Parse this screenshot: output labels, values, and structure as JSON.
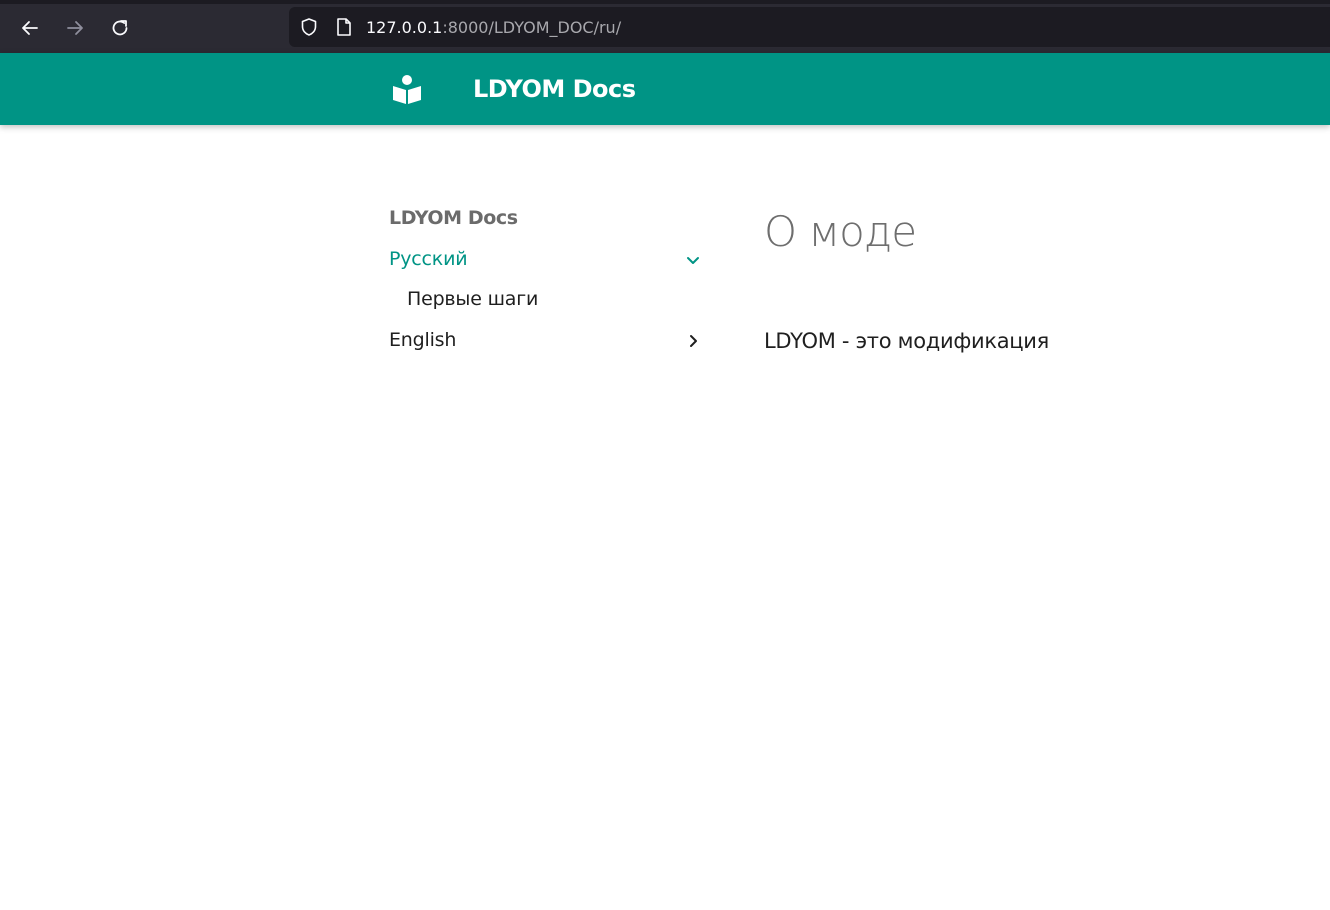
{
  "browser": {
    "url_host": "127.0.0.1",
    "url_rest": ":8000/LDYOM_DOC/ru/"
  },
  "header": {
    "logo_icon": "book-reader-icon",
    "title": "LDYOM Docs"
  },
  "sidebar": {
    "root_title": "LDYOM Docs",
    "items": [
      {
        "label": "Русский",
        "state": "expanded",
        "active": true,
        "icon": "chevron-down-icon"
      },
      {
        "label": "Первые шаги",
        "level": 2
      },
      {
        "label": "English",
        "state": "collapsed",
        "icon": "chevron-right-icon"
      }
    ]
  },
  "main": {
    "heading": "О моде",
    "intro": "LDYOM - это модификация"
  },
  "colors": {
    "accent": "#009485",
    "browser_bg": "#2b2a33",
    "urlbar_bg": "#1c1b22"
  }
}
